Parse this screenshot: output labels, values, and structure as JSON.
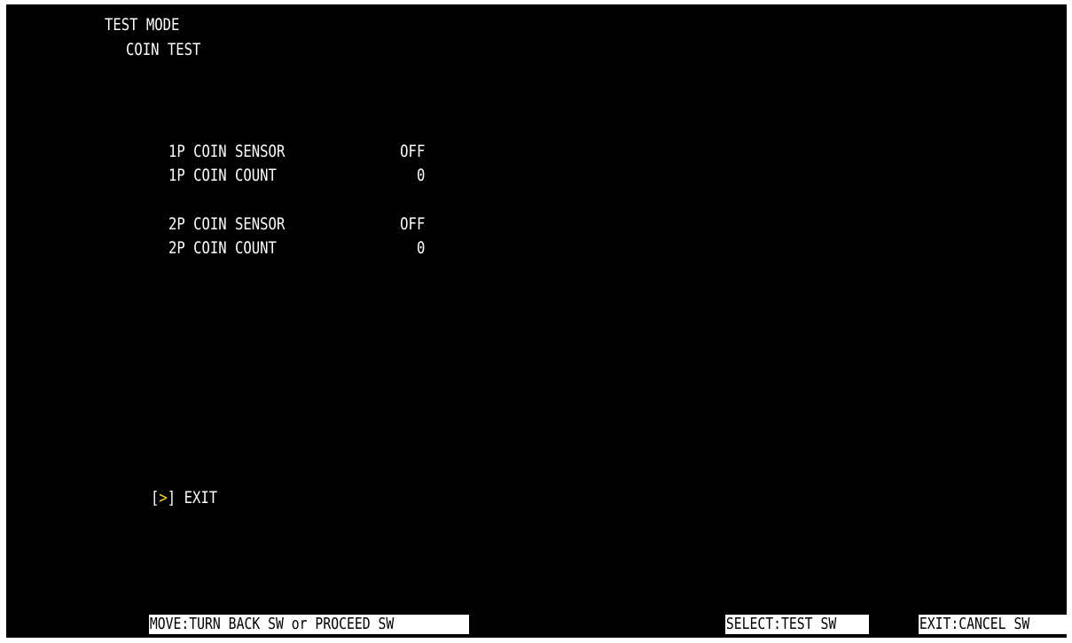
{
  "header": {
    "title": "TEST MODE",
    "subtitle": "COIN TEST"
  },
  "rows": [
    {
      "label": "1P COIN SENSOR",
      "value": "OFF"
    },
    {
      "label": "1P COIN COUNT",
      "value": "0"
    },
    {
      "label": "2P COIN SENSOR",
      "value": "OFF"
    },
    {
      "label": "2P COIN COUNT",
      "value": "0"
    }
  ],
  "menu": {
    "cursor_open": "[",
    "cursor_arrow": ">",
    "cursor_close": "]",
    "exit_label": "EXIT",
    "cursor_color": "#f2d23a"
  },
  "footer": {
    "move": "MOVE:TURN BACK SW or PROCEED SW",
    "select": "SELECT:TEST SW",
    "exit": "EXIT:CANCEL SW"
  }
}
